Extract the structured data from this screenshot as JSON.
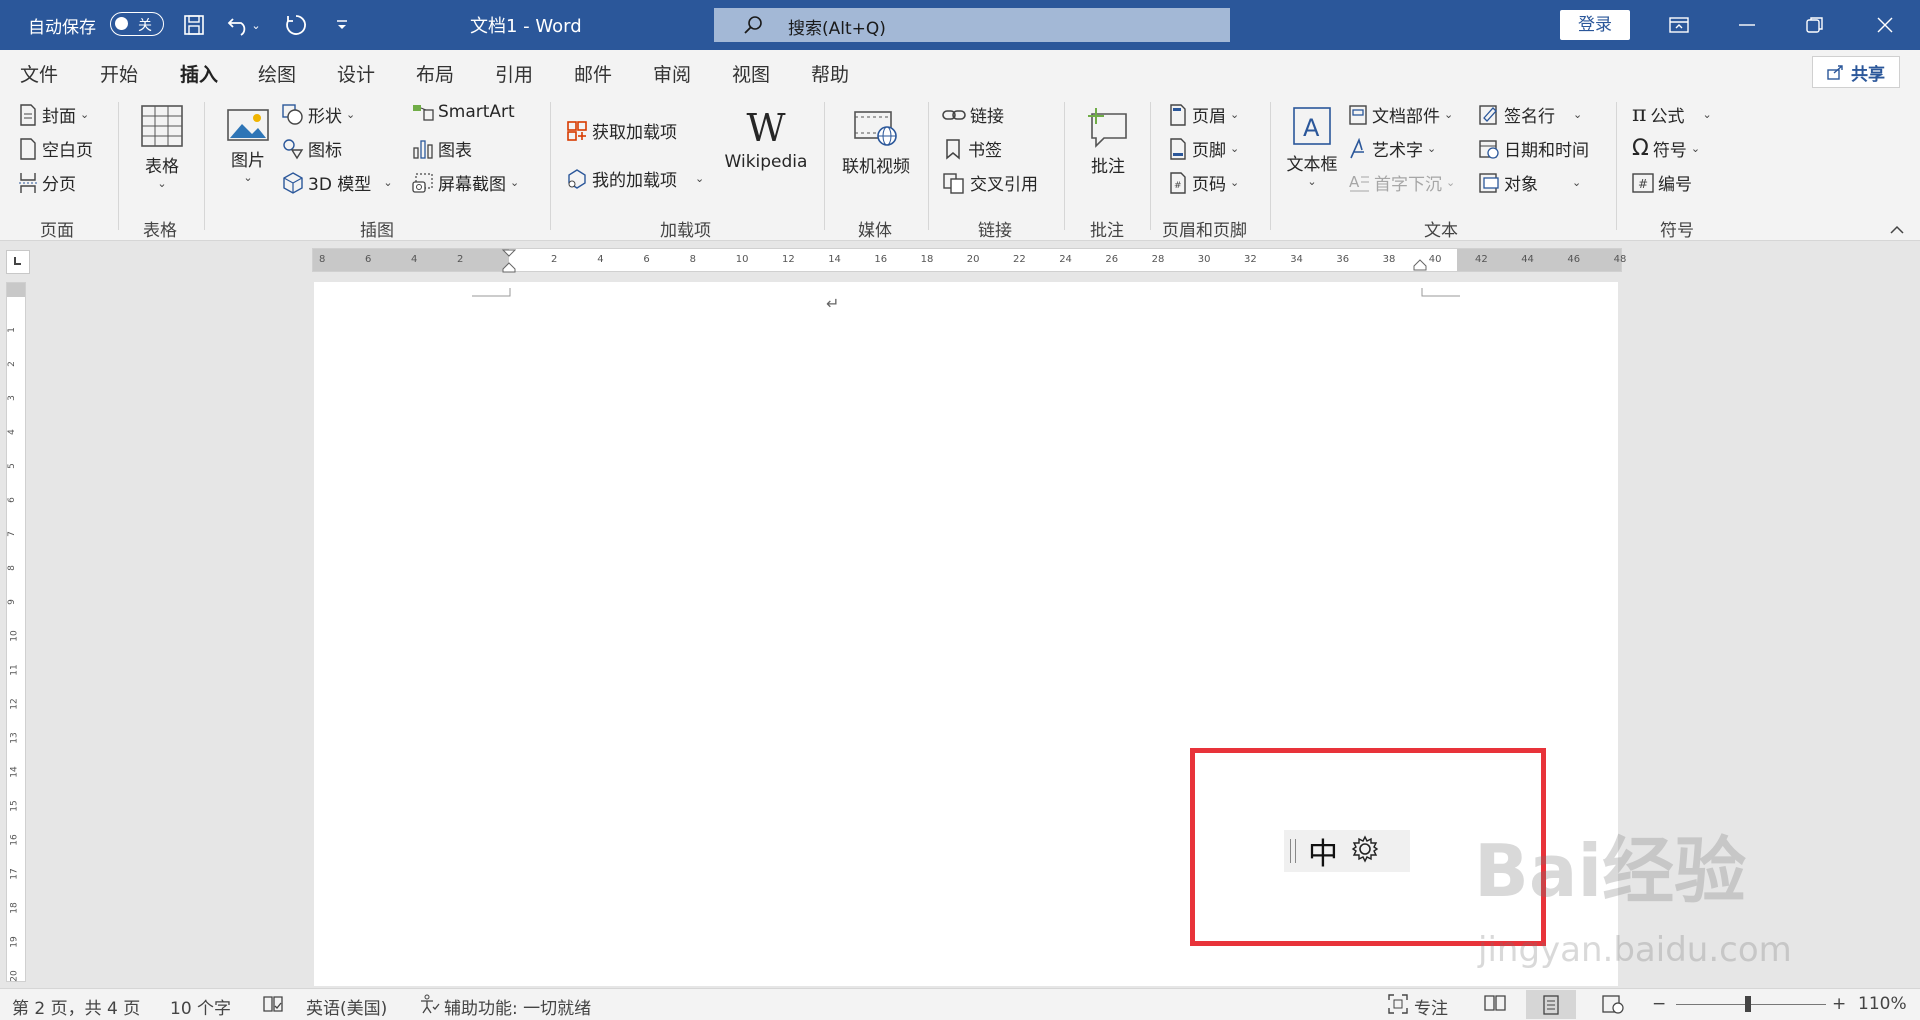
{
  "titlebar": {
    "autosave_label": "自动保存",
    "autosave_state": "关",
    "title": "文档1  -  Word",
    "search_placeholder": "搜索(Alt+Q)",
    "login_label": "登录"
  },
  "tabs": [
    "文件",
    "开始",
    "插入",
    "绘图",
    "设计",
    "布局",
    "引用",
    "邮件",
    "审阅",
    "视图",
    "帮助"
  ],
  "active_tab": "插入",
  "share_label": "共享",
  "ribbon": {
    "pages": {
      "cover": "封面",
      "blank": "空白页",
      "break": "分页",
      "label": "页面"
    },
    "tables": {
      "table": "表格",
      "label": "表格"
    },
    "illustrations": {
      "picture": "图片",
      "shapes": "形状",
      "icons": "图标",
      "model3d": "3D 模型",
      "smartart": "SmartArt",
      "chart": "图表",
      "screenshot": "屏幕截图",
      "label": "插图"
    },
    "addins": {
      "get": "获取加载项",
      "my": "我的加载项",
      "wikipedia": "Wikipedia",
      "label": "加载项"
    },
    "media": {
      "online_video": "联机视频",
      "label": "媒体"
    },
    "links": {
      "link": "链接",
      "bookmark": "书签",
      "crossref": "交叉引用",
      "label": "链接"
    },
    "comments": {
      "comment": "批注",
      "label": "批注"
    },
    "header_footer": {
      "header": "页眉",
      "footer": "页脚",
      "page_number": "页码",
      "label": "页眉和页脚"
    },
    "text": {
      "textbox": "文本框",
      "quickparts": "文档部件",
      "wordart": "艺术字",
      "dropcap": "首字下沉",
      "signature": "签名行",
      "datetime": "日期和时间",
      "object": "对象",
      "label": "文本"
    },
    "symbols": {
      "equation": "公式",
      "symbol": "符号",
      "number": "编号",
      "label": "符号"
    }
  },
  "ruler": {
    "left_ticks": [
      "8",
      "6",
      "4",
      "2"
    ],
    "right_ticks": [
      "2",
      "4",
      "6",
      "8",
      "10",
      "12",
      "14",
      "16",
      "18",
      "20",
      "22",
      "24",
      "26",
      "28",
      "30",
      "32",
      "34",
      "36",
      "38",
      "40",
      "42",
      "44",
      "46",
      "48"
    ],
    "vertical_ticks": [
      "1",
      "2",
      "3",
      "4",
      "5",
      "6",
      "7",
      "8",
      "9",
      "10",
      "11",
      "12",
      "13",
      "14",
      "15",
      "16",
      "17",
      "18",
      "19",
      "20"
    ]
  },
  "document": {
    "paragraph_mark": "↵"
  },
  "ime": {
    "mode": "中"
  },
  "watermark": {
    "brand": "Bai经验",
    "url": "jingyan.baidu.com"
  },
  "status": {
    "page": "第 2 页，共 4 页",
    "words": "10 个字",
    "language": "英语(美国)",
    "accessibility": "辅助功能: 一切就绪",
    "focus": "专注",
    "zoom": "110%"
  },
  "colors": {
    "titlebar": "#2b579a",
    "highlight_box": "#e8333a"
  }
}
